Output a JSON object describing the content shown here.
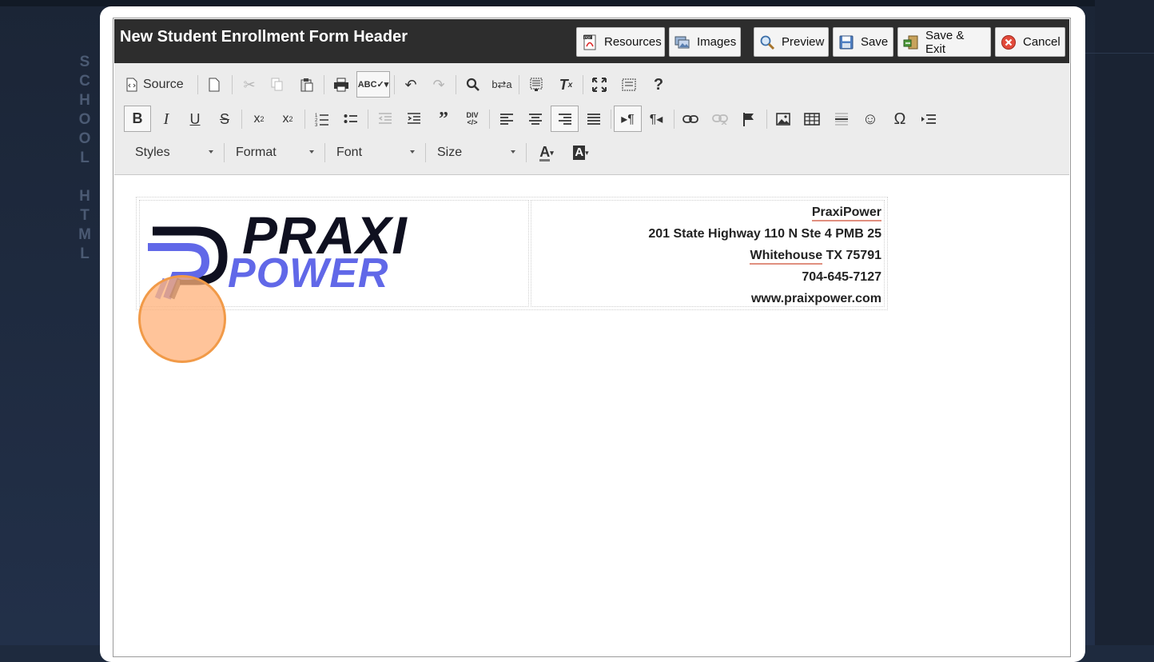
{
  "background": {
    "vertical_label": [
      "S",
      "C",
      "H",
      "O",
      "O",
      "L",
      " ",
      "H",
      "T",
      "M",
      "L"
    ]
  },
  "editor": {
    "title": "New Student Enrollment Form Header",
    "buttons": {
      "resources": "Resources",
      "images": "Images",
      "preview": "Preview",
      "save": "Save",
      "save_exit": "Save & Exit",
      "cancel": "Cancel"
    },
    "toolbar": {
      "source_label": "Source",
      "combos": {
        "styles": "Styles",
        "format": "Format",
        "font": "Font",
        "size": "Size"
      }
    }
  },
  "document": {
    "logo": {
      "line1": "PRAXI",
      "line2": "POWER"
    },
    "address": {
      "company": "PraxiPower",
      "street": "201 State Highway 110 N Ste 4 PMB 25",
      "city": "Whitehouse",
      "state_zip": "TX 75791",
      "phone": "704-645-7127",
      "website": "www.praixpower.com"
    }
  },
  "colors": {
    "titlebar": "#2d2d2d",
    "toolbar": "#ececec",
    "logo_dark": "#0f1020",
    "logo_accent": "#6168e8",
    "spell_underline": "#e08f7f",
    "click_marker": "#f19a48"
  }
}
